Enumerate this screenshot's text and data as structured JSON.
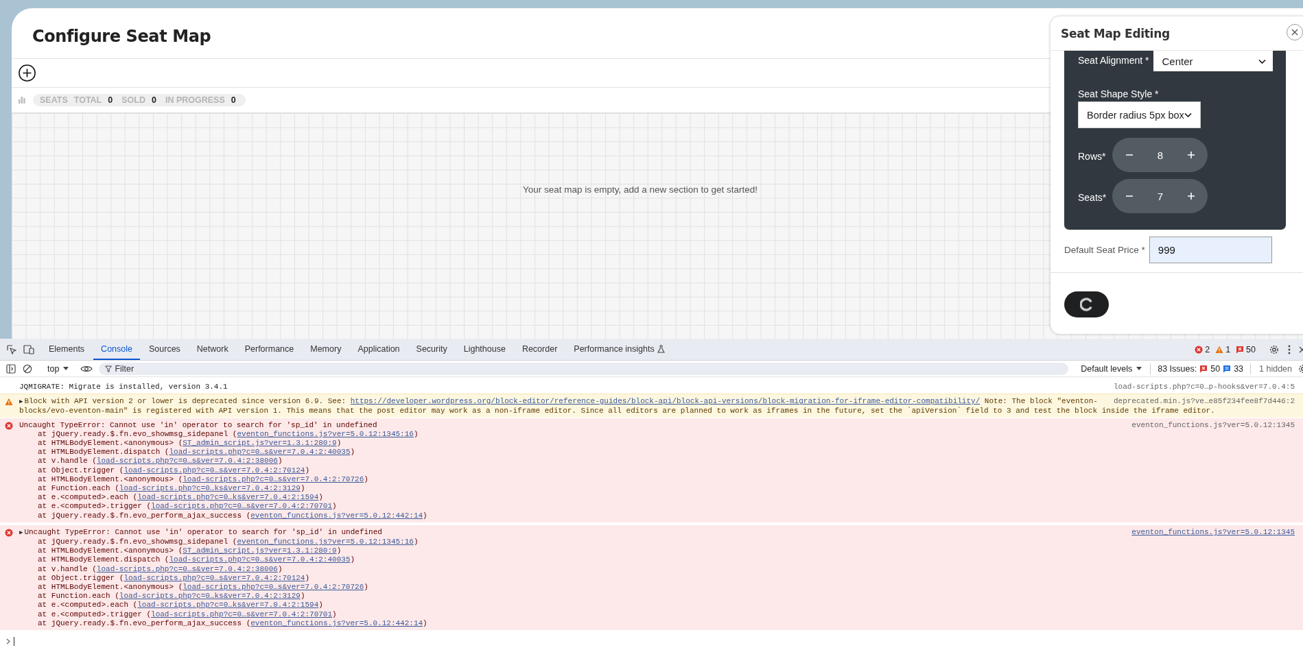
{
  "page": {
    "title": "Configure Seat Map",
    "stats": {
      "label": "SEATS",
      "items": [
        {
          "label": "TOTAL",
          "value": "0"
        },
        {
          "label": "SOLD",
          "value": "0"
        },
        {
          "label": "IN PROGRESS",
          "value": "0"
        }
      ]
    },
    "empty_message": "Your seat map is empty, add a new section to get started!"
  },
  "panel": {
    "title": "Seat Map Editing",
    "fields": [
      {
        "kind": "inline-select",
        "label": "Seat Alignment *",
        "value": "Center"
      },
      {
        "kind": "select",
        "label": "Seat Shape Style *",
        "value": "Border radius 5px box"
      },
      {
        "kind": "stepper",
        "label": "Rows*",
        "value": "8"
      },
      {
        "kind": "stepper",
        "label": "Seats*",
        "value": "7"
      }
    ],
    "price": {
      "label": "Default Seat Price *",
      "value": "999"
    },
    "save_button": {
      "loading": true
    }
  },
  "devtools": {
    "tabs": [
      {
        "label": "Elements",
        "selected": false
      },
      {
        "label": "Console",
        "selected": true
      },
      {
        "label": "Sources",
        "selected": false
      },
      {
        "label": "Network",
        "selected": false
      },
      {
        "label": "Performance",
        "selected": false
      },
      {
        "label": "Memory",
        "selected": false
      },
      {
        "label": "Application",
        "selected": false
      },
      {
        "label": "Security",
        "selected": false
      },
      {
        "label": "Lighthouse",
        "selected": false
      },
      {
        "label": "Recorder",
        "selected": false
      },
      {
        "label": "Performance insights",
        "selected": false,
        "experimental": true
      }
    ],
    "counts": {
      "errors": "2",
      "warnings": "1",
      "issues": "50"
    },
    "context": "top",
    "filter": {
      "placeholder": "Filter"
    },
    "levels": "Default levels",
    "issues": {
      "label": "83 Issues:",
      "errors": "50",
      "info": "33"
    },
    "hidden": "1 hidden",
    "messages": [
      {
        "kind": "log",
        "text": "JQMIGRATE: Migrate is installed, version 3.4.1",
        "source": "load-scripts.php?c=0…p-hooks&ver=7.0.4:5",
        "source_linked": false
      },
      {
        "kind": "warning",
        "toggle": "▶",
        "lines": [
          {
            "text": "Block with API version 2 or lower is deprecated since version 6.9. See: ",
            "link": "https://developer.wordpress.org/block-editor/reference-guides/block-api/block-api-versions/block-migration-for-iframe-editor-compatibility/",
            "after": " Note: The block \"eventon-"
          },
          {
            "text": "blocks/evo-eventon-main\" is registered with API version 1. This means that the post editor may work as a non-iframe editor. Since all editors are planned to work as iframes in the future, set the `apiVersion` field to 3 and test the block inside the iframe editor."
          }
        ],
        "source": "deprecated.min.js?ve…e85f234fee8f7d446:2",
        "source_linked": false
      },
      {
        "kind": "error",
        "text": "Uncaught TypeError: Cannot use 'in' operator to search for 'sp_id' in undefined",
        "source": "eventon_functions.js?ver=5.0.12:1345",
        "source_linked": false,
        "frames": [
          {
            "text": "at jQuery.ready.$.fn.evo_showmsg_sidepanel (",
            "link": "eventon_functions.js?ver=5.0.12:1345:16",
            "end": ")"
          },
          {
            "text": "at HTMLBodyElement.<anonymous> (",
            "link": "ST_admin_script.js?ver=1.3.1:280:9",
            "end": ")"
          },
          {
            "text": "at HTMLBodyElement.dispatch (",
            "link": "load-scripts.php?c=0…s&ver=7.0.4:2:40035",
            "end": ")"
          },
          {
            "text": "at v.handle (",
            "link": "load-scripts.php?c=0…s&ver=7.0.4:2:38006",
            "end": ")"
          },
          {
            "text": "at Object.trigger (",
            "link": "load-scripts.php?c=0…s&ver=7.0.4:2:70124",
            "end": ")"
          },
          {
            "text": "at HTMLBodyElement.<anonymous> (",
            "link": "load-scripts.php?c=0…s&ver=7.0.4:2:70726",
            "end": ")"
          },
          {
            "text": "at Function.each (",
            "link": "load-scripts.php?c=0…ks&ver=7.0.4:2:3129",
            "end": ")"
          },
          {
            "text": "at e.<computed>.each (",
            "link": "load-scripts.php?c=0…ks&ver=7.0.4:2:1594",
            "end": ")"
          },
          {
            "text": "at e.<computed>.trigger (",
            "link": "load-scripts.php?c=0…s&ver=7.0.4:2:70701",
            "end": ")"
          },
          {
            "text": "at jQuery.ready.$.fn.evo_perform_ajax_success (",
            "link": "eventon_functions.js?ver=5.0.12:442:14",
            "end": ")"
          }
        ]
      },
      {
        "kind": "error",
        "toggle": "▶",
        "text": "Uncaught TypeError: Cannot use 'in' operator to search for 'sp_id' in undefined",
        "source": "eventon_functions.js?ver=5.0.12:1345",
        "source_linked": true,
        "frames": [
          {
            "text": "at jQuery.ready.$.fn.evo_showmsg_sidepanel (",
            "link": "eventon_functions.js?ver=5.0.12:1345:16",
            "end": ")"
          },
          {
            "text": "at HTMLBodyElement.<anonymous> (",
            "link": "ST_admin_script.js?ver=1.3.1:280:9",
            "end": ")"
          },
          {
            "text": "at HTMLBodyElement.dispatch (",
            "link": "load-scripts.php?c=0…s&ver=7.0.4:2:40035",
            "end": ")"
          },
          {
            "text": "at v.handle (",
            "link": "load-scripts.php?c=0…s&ver=7.0.4:2:38006",
            "end": ")"
          },
          {
            "text": "at Object.trigger (",
            "link": "load-scripts.php?c=0…s&ver=7.0.4:2:70124",
            "end": ")"
          },
          {
            "text": "at HTMLBodyElement.<anonymous> (",
            "link": "load-scripts.php?c=0…s&ver=7.0.4:2:70726",
            "end": ")"
          },
          {
            "text": "at Function.each (",
            "link": "load-scripts.php?c=0…ks&ver=7.0.4:2:3129",
            "end": ")"
          },
          {
            "text": "at e.<computed>.each (",
            "link": "load-scripts.php?c=0…ks&ver=7.0.4:2:1594",
            "end": ")"
          },
          {
            "text": "at e.<computed>.trigger (",
            "link": "load-scripts.php?c=0…s&ver=7.0.4:2:70701",
            "end": ")"
          },
          {
            "text": "at jQuery.ready.$.fn.evo_perform_ajax_success (",
            "link": "eventon_functions.js?ver=5.0.12:442:14",
            "end": ")"
          }
        ]
      }
    ]
  }
}
